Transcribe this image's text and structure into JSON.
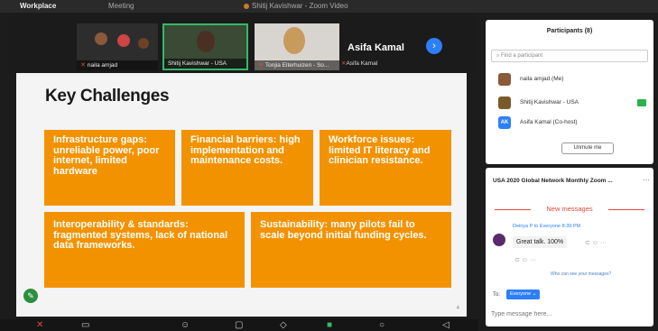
{
  "app": {
    "title": "Workplace",
    "tab1": "Meeting",
    "tab2": "Shitij Kavishwar - Zoom Video"
  },
  "strip": {
    "tiles": [
      {
        "name": "naila amjad"
      },
      {
        "name": "Shitij Kavishwar - USA"
      },
      {
        "name": "Tonjia Elterhuizen - So...",
        "extra": "Asifa Kamal"
      }
    ],
    "speaker": "Asifa Kamal",
    "next_label": "›"
  },
  "slide": {
    "title": "Key Challenges",
    "cards": [
      "Infrastructure gaps: unreliable power, poor internet, limited hardware",
      "Financial barriers: high implementation and maintenance costs.",
      "Workforce issues: limited IT literacy and clinician resistance.",
      "Interoperability & standards: fragmented systems, lack of national data frameworks.",
      "Sustainability: many pilots fail to scale beyond initial funding cycles."
    ],
    "page": "4"
  },
  "participants": {
    "title": "Participants (8)",
    "search_placeholder": "Find a participant",
    "list": [
      {
        "name": "naila amjad (Me)"
      },
      {
        "name": "Shitij Kavishwar - USA"
      },
      {
        "name": "Asifa Kamal (Co-host)",
        "initials": "AK"
      }
    ],
    "unmute_label": "Unmute me"
  },
  "chat": {
    "title": "USA 2020 Global Network Monthly Zoom ...",
    "more": "···",
    "new_messages": "New messages",
    "sender_line": "Deinya P to Everyone 8:39 PM",
    "message": "Great talk. 100%",
    "actions": "⊂ ☺ ···",
    "actions2": "⊂ ☺ ···",
    "who_can_see": "Who can see your messages?",
    "to_label": "To:",
    "to_value": "Everyone ⌄",
    "input_placeholder": "Type message here..."
  },
  "colors": {
    "accent": "#f39200",
    "zoom_blue": "#2d7ff9",
    "active_green": "#35b86a"
  }
}
